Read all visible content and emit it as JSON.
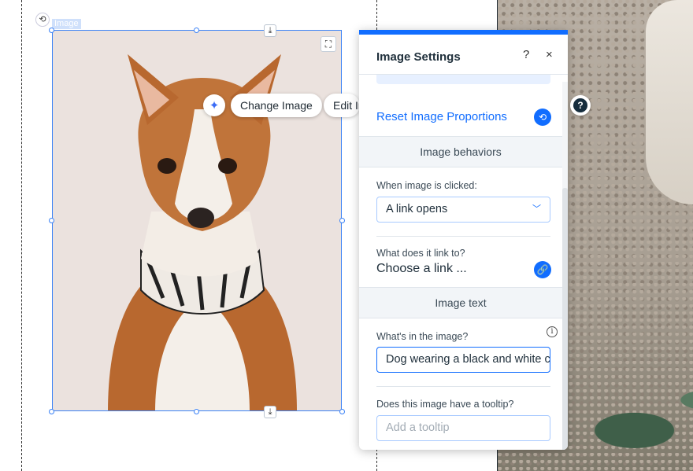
{
  "canvas": {
    "image_tag": "Image",
    "floating_toolbar": {
      "change_image_label": "Change Image",
      "edit_image_label": "Edit Image"
    },
    "help_label": "?"
  },
  "panel": {
    "title": "Image Settings",
    "help": "?",
    "close": "×",
    "reset_proportions": "Reset Image Proportions",
    "behaviors_header": "Image behaviors",
    "click_label": "When image is clicked:",
    "click_value": "A link opens",
    "link_label": "What does it link to?",
    "link_value": "Choose a link ...",
    "image_text_header": "Image text",
    "alt_label": "What's in the image?",
    "alt_value": "Dog wearing a black and white collar",
    "tooltip_label": "Does this image have a tooltip?",
    "tooltip_placeholder": "Add a tooltip"
  },
  "colors": {
    "accent": "#116dff",
    "selection": "#3b82f6",
    "panel_section_bg": "#f2f5f8"
  }
}
